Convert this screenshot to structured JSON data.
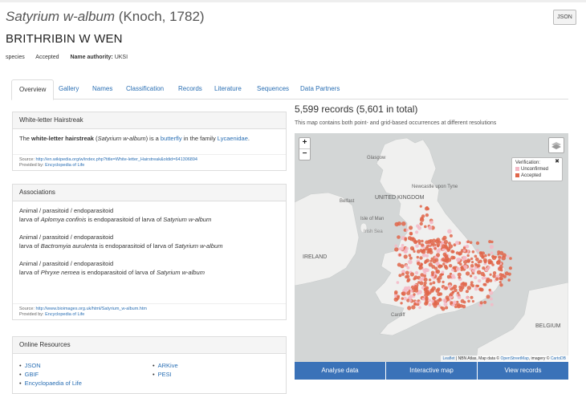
{
  "header": {
    "scientific_name": "Satyrium w-album",
    "authorship": "(Knoch, 1782)",
    "common_name": "BRITHRIBIN W WEN",
    "rank": "species",
    "status": "Accepted",
    "name_authority_label": "Name authority:",
    "name_authority_value": "UKSI",
    "json_button": "JSON"
  },
  "tabs": [
    "Overview",
    "Gallery",
    "Names",
    "Classification",
    "Records",
    "Literature",
    "Sequences",
    "Data Partners"
  ],
  "description_panel": {
    "title": "White-letter Hairstreak",
    "text_1": "The ",
    "text_bold": "white-letter hairstreak",
    "text_2": " (",
    "text_italic": "Satyrium w-album",
    "text_3": ") is a ",
    "link_butterfly": "butterfly",
    "text_4": " in the family ",
    "link_family": "Lycaenidae",
    "text_5": ".",
    "source_label": "Source:",
    "source_url": "http://en.wikipedia.org/w/index.php?title=White-letter_Hairstreak&oldid=641306894",
    "provided_label": "Provided by:",
    "provided_by": "Encyclopedia of Life"
  },
  "associations_panel": {
    "title": "Associations",
    "items": [
      {
        "type": "Animal / parasitoid / endoparasitoid",
        "pre": "larva of ",
        "species": "Aplomya confinis",
        "mid": " is endoparasitoid of larva of ",
        "host": "Satyrium w-album"
      },
      {
        "type": "Animal / parasitoid / endoparasitoid",
        "pre": "larva of ",
        "species": "Bactromyia aurulenta",
        "mid": " is endoparasitoid of larva of ",
        "host": "Satyrium w-album"
      },
      {
        "type": "Animal / parasitoid / endoparasitoid",
        "pre": "larva of ",
        "species": "Phryxe nemea",
        "mid": " is endoparasitoid of larva of ",
        "host": "Satyrium w-album"
      }
    ],
    "source_label": "Source:",
    "source_url": "http://www.bioimages.org.uk/html/Satyrium_w-album.htm",
    "provided_label": "Provided by:",
    "provided_by": "Encyclopedia of Life"
  },
  "online_resources": {
    "title": "Online Resources",
    "col1": [
      "JSON",
      "GBIF",
      "Encyclopaedia of Life"
    ],
    "col2": [
      "ARKive",
      "PESI"
    ]
  },
  "records": {
    "title": "5,599 records (5,601 in total)",
    "subtitle": "This map contains both point- and grid-based occurrences at different resolutions"
  },
  "map": {
    "zoom_in": "+",
    "zoom_out": "−",
    "legend_title": "Verification:",
    "legend_close": "✖",
    "legend_items": [
      {
        "label": "Unconfirmed",
        "color": "#f4b9c6"
      },
      {
        "label": "Accepted",
        "color": "#e0664a"
      }
    ],
    "labels": [
      "Glasgow",
      "Newcastle upon Tyne",
      "UNITED KINGDOM",
      "Belfast",
      "Isle of Man",
      "Irish Sea",
      "IRELAND",
      "Cardiff",
      "BELGIUM"
    ],
    "attribution_leaflet": "Leaflet",
    "attribution_rest": " | NBN Atlas, Map data © ",
    "attribution_osm": "OpenStreetMap",
    "attribution_mid": ", imagery © ",
    "attribution_carto": "CartoDB",
    "colors": {
      "land": "#f0f0ef",
      "sea": "#d3d6d6",
      "accepted": "#e0664a",
      "unconfirmed": "#f4b9c6"
    }
  },
  "map_buttons": [
    "Analyse data",
    "Interactive map",
    "View records"
  ],
  "colors": {
    "link": "#2a6fb4",
    "button": "#3a72b8"
  }
}
